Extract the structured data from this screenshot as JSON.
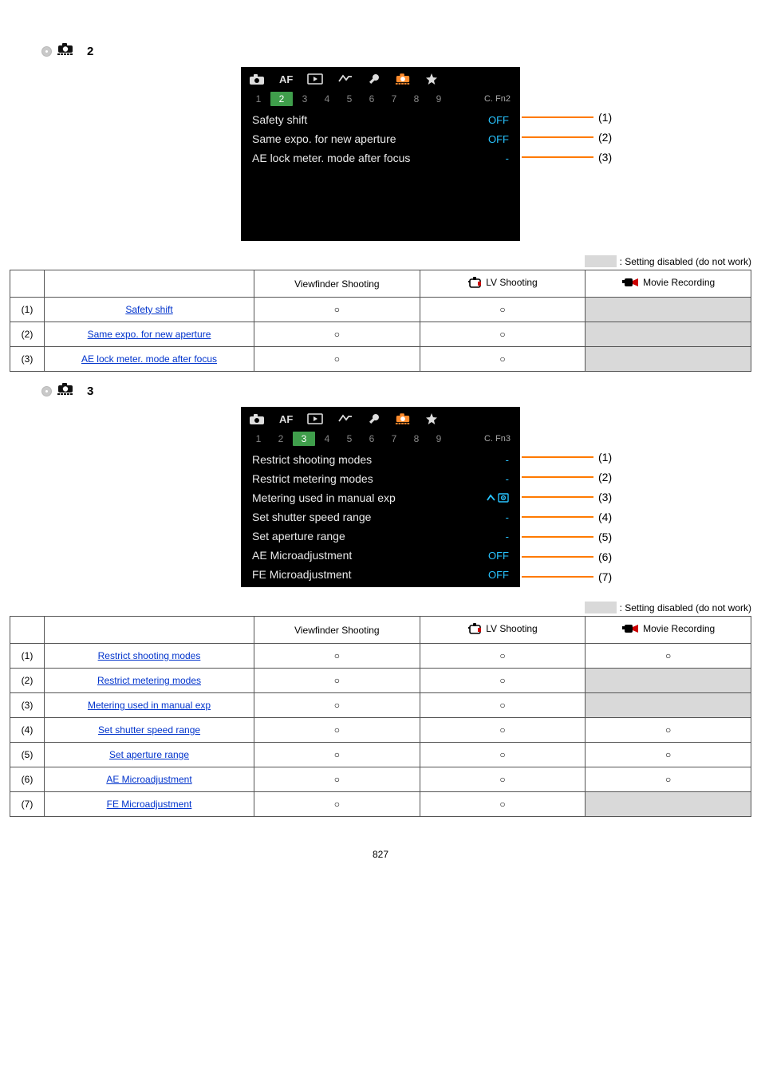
{
  "sections": [
    {
      "num_suffix": "2",
      "active_sub": "2",
      "tab_end": "C. Fn2",
      "menu": [
        {
          "label": "Safety shift",
          "val": "OFF",
          "ann": "(1)"
        },
        {
          "label": "Same expo. for new aperture",
          "val": "OFF",
          "ann": "(2)"
        },
        {
          "label": "AE lock meter. mode after focus",
          "val": "-",
          "ann": "(3)"
        }
      ],
      "blank_rows": 4,
      "table": [
        {
          "idx": "(1)",
          "name": "Safety shift",
          "vf": "○",
          "lv": "○",
          "mov": "disabled"
        },
        {
          "idx": "(2)",
          "name": "Same expo. for new aperture",
          "vf": "○",
          "lv": "○",
          "mov": "disabled"
        },
        {
          "idx": "(3)",
          "name": "AE lock meter. mode after focus",
          "vf": "○",
          "lv": "○",
          "mov": "disabled"
        }
      ]
    },
    {
      "num_suffix": "3",
      "active_sub": "3",
      "tab_end": "C. Fn3",
      "menu": [
        {
          "label": "Restrict shooting modes",
          "val": "-",
          "ann": "(1)"
        },
        {
          "label": "Restrict metering modes",
          "val": "-",
          "ann": "(2)"
        },
        {
          "label": "Metering used in manual exp",
          "val": "✓▣",
          "ann": "(3)"
        },
        {
          "label": "Set shutter speed range",
          "val": "-",
          "ann": "(4)"
        },
        {
          "label": "Set aperture range",
          "val": "-",
          "ann": "(5)"
        },
        {
          "label": "AE Microadjustment",
          "val": "OFF",
          "ann": "(6)"
        },
        {
          "label": "FE Microadjustment",
          "val": "OFF",
          "ann": "(7)"
        }
      ],
      "blank_rows": 0,
      "table": [
        {
          "idx": "(1)",
          "name": "Restrict shooting modes",
          "vf": "○",
          "lv": "○",
          "mov": "○"
        },
        {
          "idx": "(2)",
          "name": "Restrict metering modes",
          "vf": "○",
          "lv": "○",
          "mov": "disabled"
        },
        {
          "idx": "(3)",
          "name": "Metering used in manual exp",
          "vf": "○",
          "lv": "○",
          "mov": "disabled"
        },
        {
          "idx": "(4)",
          "name": "Set shutter speed range",
          "vf": "○",
          "lv": "○",
          "mov": "○"
        },
        {
          "idx": "(5)",
          "name": "Set aperture range",
          "vf": "○",
          "lv": "○",
          "mov": "○"
        },
        {
          "idx": "(6)",
          "name": "AE Microadjustment",
          "vf": "○",
          "lv": "○",
          "mov": "○"
        },
        {
          "idx": "(7)",
          "name": "FE Microadjustment",
          "vf": "○",
          "lv": "○",
          "mov": "disabled"
        }
      ]
    }
  ],
  "subtabs": [
    "1",
    "2",
    "3",
    "4",
    "5",
    "6",
    "7",
    "8",
    "9"
  ],
  "legend_text": ": Setting disabled (do not work)",
  "table_headers": {
    "vf": "Viewfinder Shooting",
    "lv": "LV Shooting",
    "mov": "Movie Recording"
  },
  "page_number": "827"
}
